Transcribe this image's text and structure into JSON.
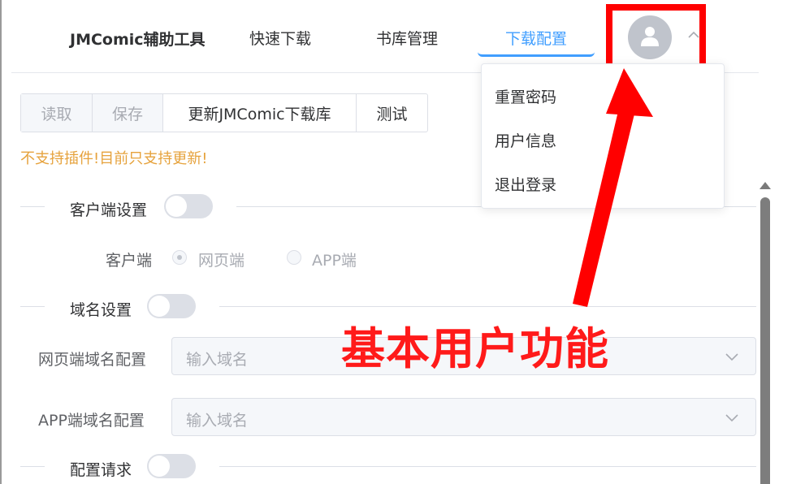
{
  "header": {
    "app_title": "JMComic辅助工具",
    "nav": [
      "快速下载",
      "书库管理",
      "下载配置"
    ],
    "active_nav": "下载配置"
  },
  "user_menu": {
    "items": [
      "重置密码",
      "用户信息",
      "退出登录"
    ]
  },
  "toolbar": {
    "buttons": [
      "读取",
      "保存",
      "更新JMComic下载库",
      "测试"
    ]
  },
  "notice": "不支持插件!目前只支持更新!",
  "sections": {
    "client": {
      "title": "客户端设置",
      "enabled": false
    },
    "domain": {
      "title": "域名设置",
      "enabled": false
    },
    "request": {
      "title": "配置请求",
      "enabled": false
    }
  },
  "client_field": {
    "label": "客户端",
    "options": [
      "网页端",
      "APP端"
    ],
    "selected": "网页端"
  },
  "domain_fields": [
    {
      "label": "网页端域名配置",
      "placeholder": "输入域名"
    },
    {
      "label": "APP端域名配置",
      "placeholder": "输入域名"
    }
  ],
  "annotation": {
    "text": "基本用户功能",
    "color": "#ff0000"
  },
  "colors": {
    "primary": "#409eff",
    "warning": "#e6a23c",
    "annotation": "#ff0000"
  }
}
